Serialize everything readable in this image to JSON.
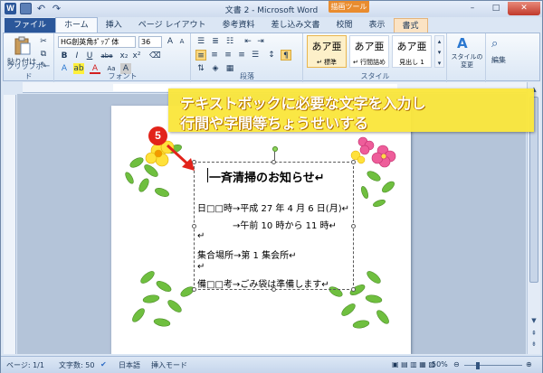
{
  "window": {
    "title": "文書 2 - Microsoft Word",
    "context_tool": "描画ツール",
    "buttons": {
      "minimize": "–",
      "maximize": "□",
      "close": "✕"
    },
    "qat": {
      "logo": "W",
      "undo": "↶",
      "redo": "↷"
    }
  },
  "tabs": [
    "ファイル",
    "ホーム",
    "挿入",
    "ページ レイアウト",
    "参考資料",
    "差し込み文書",
    "校閲",
    "表示",
    "書式"
  ],
  "ribbon": {
    "clipboard": {
      "paste": "貼り付け",
      "label": "クリップボード"
    },
    "font": {
      "font_name": "HG創英角ﾎﾟｯﾌﾟ体",
      "font_size": "36",
      "label": "フォント",
      "glyphs": [
        "B",
        "I",
        "U",
        "abe",
        "x₂",
        "x²",
        "A",
        "Aa",
        "A",
        "A"
      ]
    },
    "paragraph": {
      "label": "段落"
    },
    "styles": {
      "label": "スタイル",
      "items": [
        {
          "preview": "あア亜",
          "name": "↵ 標準"
        },
        {
          "preview": "あア亜",
          "name": "↵ 行間詰め"
        },
        {
          "preview": "あア亜",
          "name": "見出し 1"
        }
      ],
      "change": "スタイルの\n変更",
      "edit": "編集"
    }
  },
  "callout": {
    "line1": "テキストボックに必要な文字を入力し",
    "line2": "行間や字間等ちょうせいする",
    "step": "5"
  },
  "document": {
    "lines": [
      "一斉清掃のお知らせ↵",
      "日□□時→平成 27 年 4 月 6 日(月)↵",
      "→午前 10 時から 11 時↵",
      "↵",
      "集合場所→第 1 集会所↵",
      "↵",
      "備□□考→ごみ袋は準備します↵"
    ]
  },
  "status": {
    "page": "ページ: 1/1",
    "words": "文字数: 50",
    "language": "日本語",
    "mode": "挿入モード",
    "zoom": "50%"
  },
  "colors": {
    "callout_bg": "#fae63c",
    "badge": "#e2231a",
    "file_tab": "#2b579a"
  }
}
